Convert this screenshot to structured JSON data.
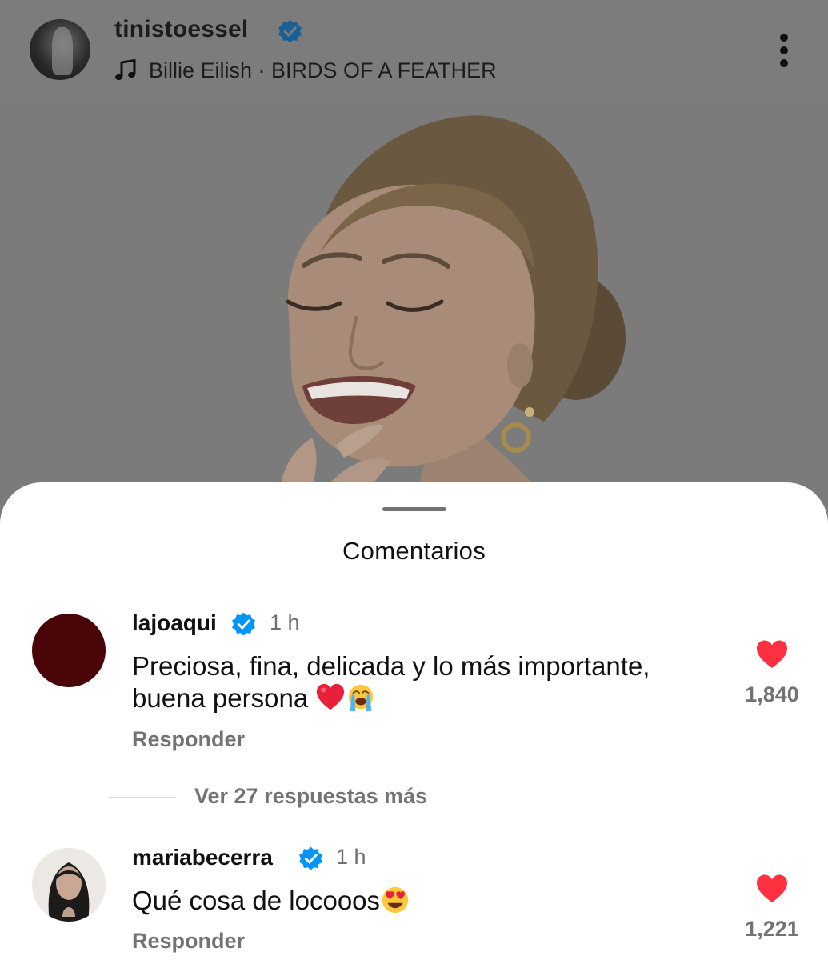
{
  "post": {
    "username": "tinistoessel",
    "verified": true,
    "music": "Billie Eilish · BIRDS OF A FEATHER",
    "icons": {
      "music": "music-note-icon",
      "more": "more-vertical-icon",
      "verified": "verified-badge-icon"
    }
  },
  "comments_sheet": {
    "title": "Comentarios",
    "comments": [
      {
        "username": "lajoaqui",
        "verified": true,
        "time": "1 h",
        "text_line1": "Preciosa, fina, delicada y lo más importante,",
        "text_line2": "buena persona",
        "emojis": [
          "red-heart-emoji",
          "loudly-crying-face-emoji"
        ],
        "likes": "1,840",
        "reply_label": "Responder",
        "avatar_color": "#4a0509"
      },
      {
        "username": "mariabecerra",
        "verified": true,
        "time": "1 h",
        "text": "Qué cosa de locooos",
        "emojis": [
          "heart-eyes-emoji"
        ],
        "likes": "1,221",
        "reply_label": "Responder"
      }
    ],
    "view_replies": "Ver 27 respuestas más"
  },
  "colors": {
    "verified_blue": "#0095f6",
    "like_red": "#ff3040",
    "secondary_text": "#737373"
  }
}
